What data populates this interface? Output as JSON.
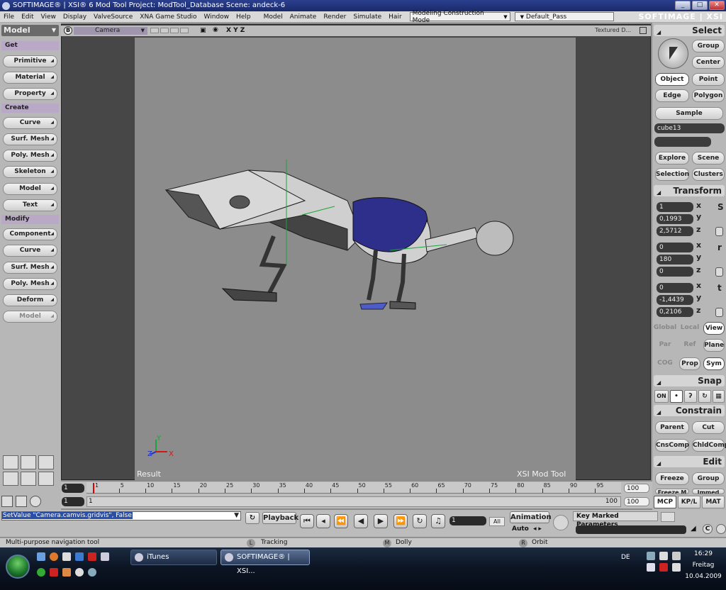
{
  "title_bar": {
    "text": "SOFTIMAGE® | XSI® 6 Mod Tool Project: ModTool_Database    Scene: andeck-6",
    "buttons": [
      "_",
      "□",
      "✕"
    ]
  },
  "brand": "SOFTIMAGE | XSI",
  "menu": {
    "items": [
      "File",
      "Edit",
      "View",
      "Display",
      "ValveSource",
      "XNA Game Studio",
      "Window",
      "Help",
      "Model",
      "Animate",
      "Render",
      "Simulate",
      "Hair"
    ],
    "mode_dropdown": "Modeling Construction Mode",
    "pass_dropdown": "Default_Pass"
  },
  "left_panel": {
    "module": "Model",
    "sections": [
      {
        "label": "Get",
        "buttons": [
          "Primitive",
          "Material",
          "Property"
        ]
      },
      {
        "label": "Create",
        "buttons": [
          "Curve",
          "Surf. Mesh",
          "Poly. Mesh",
          "Skeleton",
          "Model",
          "Text"
        ]
      },
      {
        "label": "Modify",
        "buttons": [
          "Component",
          "Curve",
          "Surf. Mesh",
          "Poly. Mesh",
          "Deform",
          "Model"
        ]
      }
    ]
  },
  "viewport": {
    "letter": "B",
    "camera": "Camera",
    "axes": "X Y Z",
    "shading": "Textured D...",
    "result_label": "Result",
    "watermark": "XSI  Mod  Tool",
    "axis_x": "X",
    "axis_y": "Y",
    "axis_z": "Z"
  },
  "right_panel": {
    "select_title": "Select",
    "select_buttons": [
      "Group",
      "Center",
      "Object",
      "Point",
      "Edge",
      "Polygon",
      "Sample"
    ],
    "selected_object": "cube13",
    "explore_buttons": [
      "Explore",
      "Scene",
      "Selection",
      "Clusters"
    ],
    "transform_title": "Transform",
    "scale": [
      "1",
      "0,1993",
      "2,5712"
    ],
    "rotate": [
      "0",
      "180",
      "0"
    ],
    "translate": [
      "0",
      "-1,4439",
      "0,2106"
    ],
    "axis_letters": [
      "x",
      "y",
      "z"
    ],
    "transform_icons": [
      "S",
      "r",
      "t"
    ],
    "space_buttons": [
      "Global",
      "Local",
      "View",
      "Par",
      "Ref",
      "Plane",
      "COG",
      "Prop",
      "Sym"
    ],
    "snap_title": "Snap",
    "snap_on": "ON",
    "constrain_title": "Constrain",
    "constrain_buttons": [
      "Parent",
      "Cut",
      "CnsComp",
      "ChldComp"
    ],
    "edit_title": "Edit",
    "edit_buttons": [
      "Freeze",
      "Group",
      "Freeze M",
      "Immed"
    ],
    "tabs": [
      "MCP",
      "KP/L",
      "MAT"
    ]
  },
  "timeline": {
    "start": "1",
    "end": "100",
    "start2": "1",
    "end2": "100",
    "range_start": "1",
    "range_end": "100",
    "ticks": [
      "1",
      "5",
      "10",
      "15",
      "20",
      "25",
      "30",
      "35",
      "40",
      "45",
      "50",
      "55",
      "60",
      "65",
      "70",
      "75",
      "80",
      "85",
      "90",
      "95"
    ]
  },
  "command_bar": {
    "command": "SetValue \"Camera.camvis.gridvis\", False",
    "playback": "Playback",
    "frame": "1",
    "all": "All",
    "animation": "Animation",
    "auto": "Auto",
    "key_marked": "Key Marked Parameters"
  },
  "status_bar": {
    "message": "Multi-purpose navigation tool",
    "keys": [
      {
        "key": "L",
        "label": "Tracking"
      },
      {
        "key": "M",
        "label": "Dolly"
      },
      {
        "key": "R",
        "label": "Orbit"
      }
    ]
  },
  "taskbar": {
    "tasks": [
      "iTunes",
      "SOFTIMAGE® | XSI..."
    ],
    "language": "DE",
    "time": "16:29",
    "day": "Freitag",
    "date": "10.04.2009"
  }
}
